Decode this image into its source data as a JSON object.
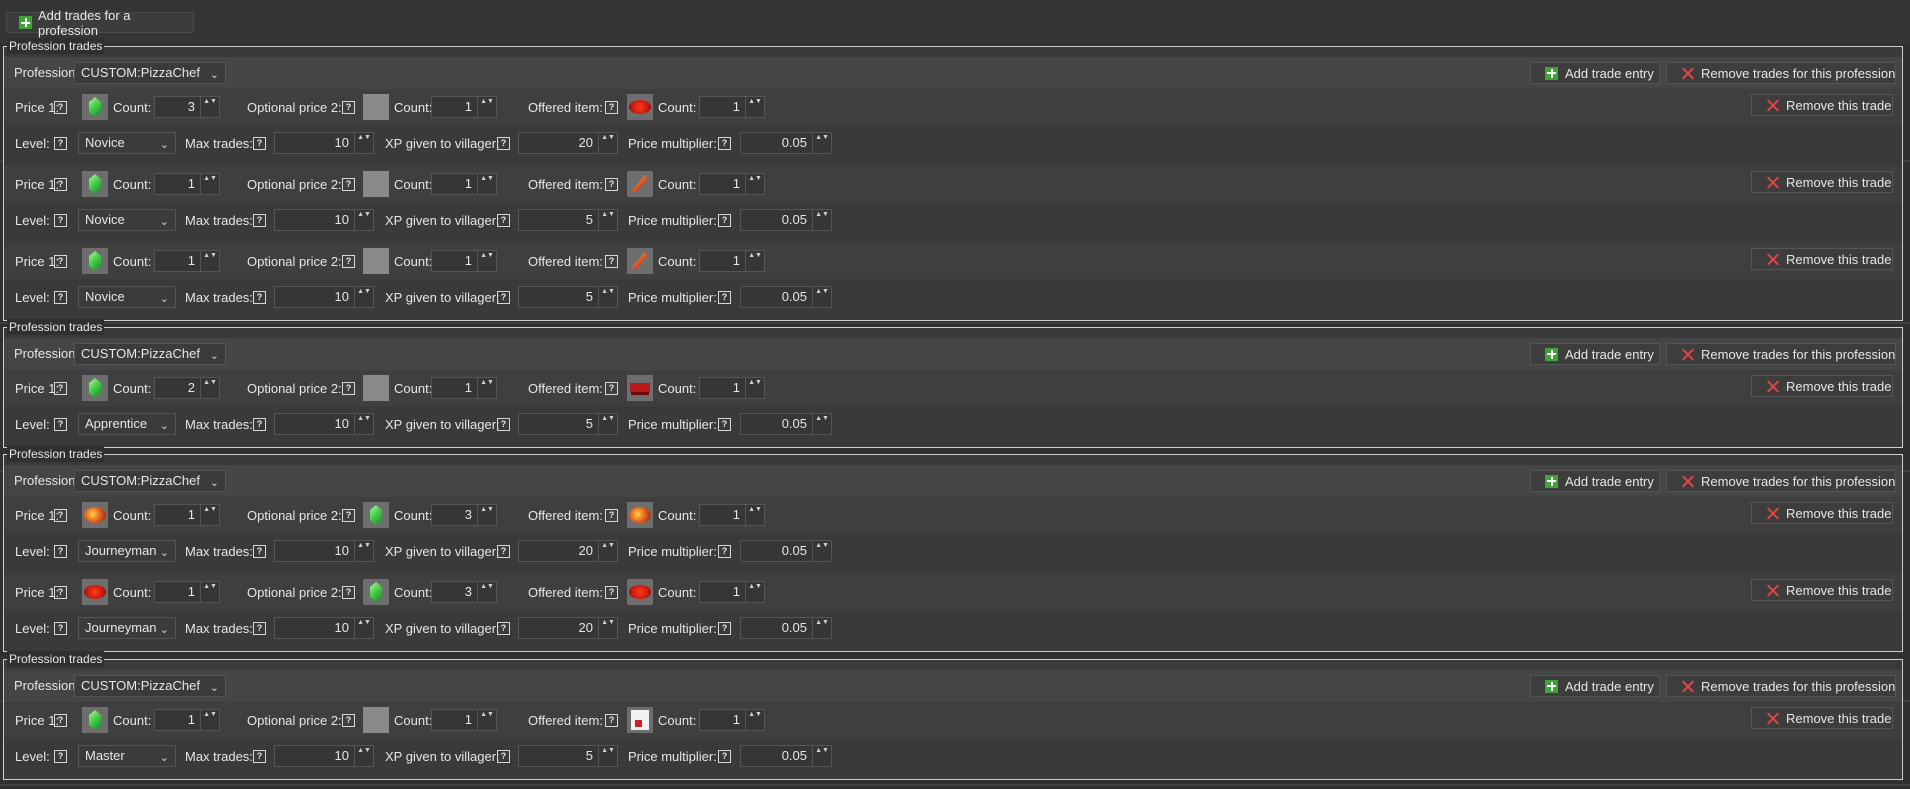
{
  "top": {
    "add_profession_label": "Add trades for a profession"
  },
  "labels": {
    "legend": "Profession trades",
    "profession": "Profession:",
    "add_trade_entry": "Add trade entry",
    "remove_trades_for_profession": "Remove trades for this profession",
    "remove_this_trade": "Remove this trade",
    "price1": "Price 1:",
    "count": "Count:",
    "optional_price2": "Optional price 2:",
    "offered_item": "Offered item:",
    "level": "Level:",
    "max_trades": "Max trades:",
    "xp_given": "XP given to villager:",
    "price_multiplier": "Price multiplier:",
    "help_glyph": "?",
    "chevron": "⌄",
    "spin_glyph": "▲▼"
  },
  "groups": [
    {
      "profession": "CUSTOM:PizzaChef",
      "trades": [
        {
          "price1_icon": "emerald-icon",
          "price1_count": "3",
          "price2_icon": "empty-slot",
          "price2_count": "1",
          "offered_icon": "red-pizza-icon",
          "offered_count": "1",
          "level": "Novice",
          "max_trades": "10",
          "xp": "20",
          "multiplier": "0.05"
        },
        {
          "price1_icon": "emerald-icon",
          "price1_count": "1",
          "price2_icon": "empty-slot",
          "price2_count": "1",
          "offered_icon": "pizza-slice-icon",
          "offered_count": "1",
          "level": "Novice",
          "max_trades": "10",
          "xp": "5",
          "multiplier": "0.05"
        },
        {
          "price1_icon": "emerald-icon",
          "price1_count": "1",
          "price2_icon": "empty-slot",
          "price2_count": "1",
          "offered_icon": "pizza-slice-icon",
          "offered_count": "1",
          "level": "Novice",
          "max_trades": "10",
          "xp": "5",
          "multiplier": "0.05"
        }
      ]
    },
    {
      "profession": "CUSTOM:PizzaChef",
      "trades": [
        {
          "price1_icon": "emerald-icon",
          "price1_count": "2",
          "price2_icon": "empty-slot",
          "price2_count": "1",
          "offered_icon": "pizza-tray-icon",
          "offered_count": "1",
          "level": "Apprentice",
          "max_trades": "10",
          "xp": "5",
          "multiplier": "0.05"
        }
      ]
    },
    {
      "profession": "CUSTOM:PizzaChef",
      "trades": [
        {
          "price1_icon": "orange-pizza-icon",
          "price1_count": "1",
          "price2_icon": "emerald-icon",
          "price2_count": "3",
          "offered_icon": "orange-pizza-icon",
          "offered_count": "1",
          "level": "Journeyman",
          "max_trades": "10",
          "xp": "20",
          "multiplier": "0.05"
        },
        {
          "price1_icon": "red-pizza-icon",
          "price1_count": "1",
          "price2_icon": "emerald-icon",
          "price2_count": "3",
          "offered_icon": "red-pizza-icon",
          "offered_count": "1",
          "level": "Journeyman",
          "max_trades": "10",
          "xp": "20",
          "multiplier": "0.05"
        }
      ]
    },
    {
      "profession": "CUSTOM:PizzaChef",
      "trades": [
        {
          "price1_icon": "emerald-icon",
          "price1_count": "1",
          "price2_icon": "empty-slot",
          "price2_count": "1",
          "offered_icon": "pizza-box-icon",
          "offered_count": "1",
          "level": "Master",
          "max_trades": "10",
          "xp": "5",
          "multiplier": "0.05"
        }
      ]
    }
  ]
}
